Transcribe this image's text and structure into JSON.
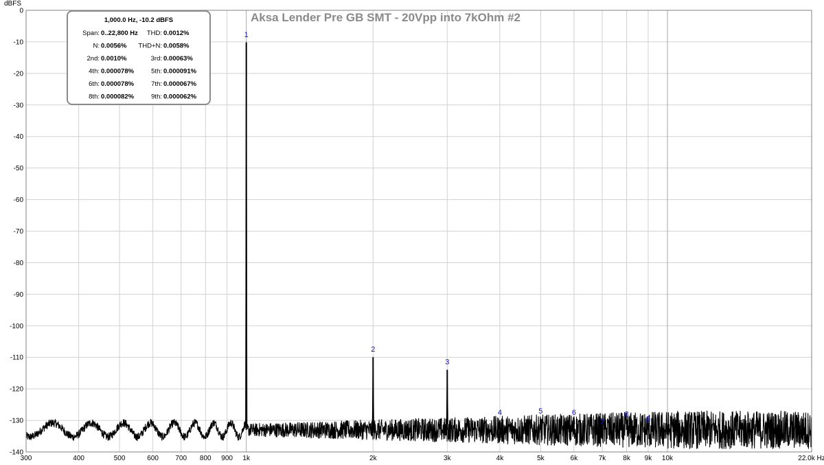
{
  "chart_data": {
    "type": "line",
    "title": "Aksa Lender Pre GB SMT - 20Vpp into 7kOhm #2",
    "ylabel": "dBFS",
    "xlabel": "Hz",
    "x_scale": "log",
    "xlim": [
      300,
      22000
    ],
    "ylim": [
      -140,
      0
    ],
    "y_ticks": [
      0,
      -10,
      -20,
      -30,
      -40,
      -50,
      -60,
      -70,
      -80,
      -90,
      -100,
      -110,
      -120,
      -130,
      -140
    ],
    "x_ticks": [
      {
        "value": 300,
        "label": "300"
      },
      {
        "value": 400,
        "label": "400"
      },
      {
        "value": 500,
        "label": "500"
      },
      {
        "value": 600,
        "label": "600"
      },
      {
        "value": 700,
        "label": "700"
      },
      {
        "value": 800,
        "label": "800"
      },
      {
        "value": 900,
        "label": "900"
      },
      {
        "value": 1000,
        "label": "1k"
      },
      {
        "value": 2000,
        "label": "2k"
      },
      {
        "value": 3000,
        "label": "3k"
      },
      {
        "value": 4000,
        "label": "4k"
      },
      {
        "value": 5000,
        "label": "5k"
      },
      {
        "value": 6000,
        "label": "6k"
      },
      {
        "value": 7000,
        "label": "7k"
      },
      {
        "value": 8000,
        "label": "8k"
      },
      {
        "value": 9000,
        "label": "9k"
      },
      {
        "value": 10000,
        "label": "10k"
      },
      {
        "value": 22000,
        "label": "22.0k Hz"
      }
    ],
    "grid": true,
    "noise_floor_db": -133,
    "peaks": [
      {
        "label": "1",
        "x": 1000,
        "y": -10.2
      },
      {
        "label": "2",
        "x": 2000,
        "y": -110
      },
      {
        "label": "3",
        "x": 3000,
        "y": -114
      },
      {
        "label": "4",
        "x": 4000,
        "y": -130
      },
      {
        "label": "5",
        "x": 5000,
        "y": -129.5
      },
      {
        "label": "6",
        "x": 6000,
        "y": -130
      },
      {
        "label": "7",
        "x": 7000,
        "y": -133
      },
      {
        "label": "8",
        "x": 8000,
        "y": -130.5
      },
      {
        "label": "9",
        "x": 9000,
        "y": -132
      }
    ],
    "legend_box": {
      "placement": "top-left",
      "header": "1,000.0 Hz, -10.2 dBFS",
      "rows": [
        [
          {
            "label": "Span:",
            "value": "0..22,800 Hz"
          },
          {
            "label": "THD:",
            "value": "0.0012%"
          }
        ],
        [
          {
            "label": "N:",
            "value": "0.0056%"
          },
          {
            "label": "THD+N:",
            "value": "0.0058%"
          }
        ],
        [
          {
            "label": "2nd:",
            "value": "0.0010%"
          },
          {
            "label": "3rd:",
            "value": "0.00063%"
          }
        ],
        [
          {
            "label": "4th:",
            "value": "0.000078%"
          },
          {
            "label": "5th:",
            "value": "0.000091%"
          }
        ],
        [
          {
            "label": "6th:",
            "value": "0.000078%"
          },
          {
            "label": "7th:",
            "value": "0.000067%"
          }
        ],
        [
          {
            "label": "8th:",
            "value": "0.000082%"
          },
          {
            "label": "9th:",
            "value": "0.000062%"
          }
        ]
      ]
    },
    "colors": {
      "trace": "#000000",
      "harmonic_labels": "#1010d0",
      "title": "#8a8a8a",
      "grid": "#d0d0d0"
    }
  }
}
